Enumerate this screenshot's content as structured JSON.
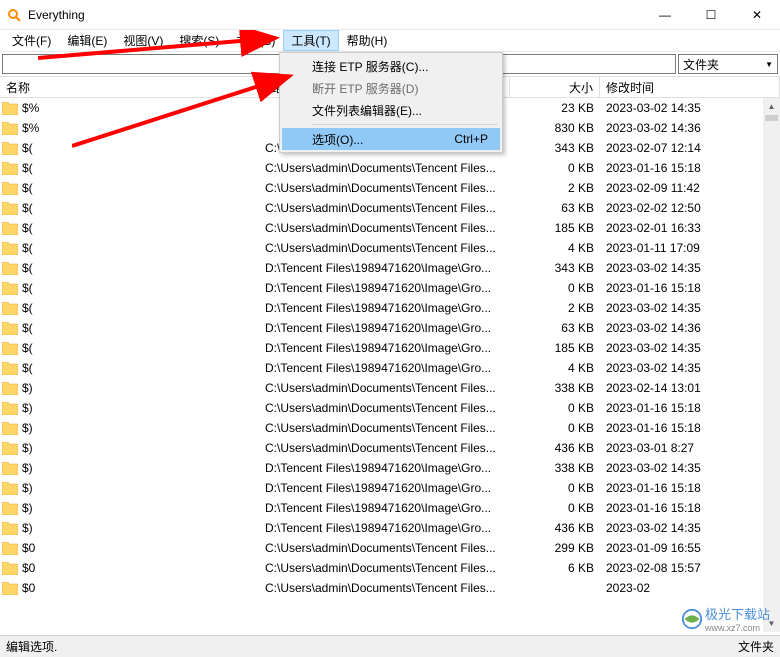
{
  "window": {
    "title": "Everything"
  },
  "win_buttons": {
    "min": "—",
    "max": "☐",
    "close": "✕"
  },
  "menubar": [
    "文件(F)",
    "编辑(E)",
    "视图(V)",
    "搜索(S)",
    "书签(B)",
    "工具(T)",
    "帮助(H)"
  ],
  "search": {
    "value": "",
    "filter": "文件夹"
  },
  "columns": {
    "name": "名称",
    "path": "路",
    "size": "大小",
    "date": "修改时间"
  },
  "dropdown": {
    "items": [
      {
        "label": "连接 ETP 服务器(C)...",
        "shortcut": "",
        "disabled": false,
        "hl": false
      },
      {
        "label": "断开 ETP 服务器(D)",
        "shortcut": "",
        "disabled": true,
        "hl": false
      },
      {
        "label": "文件列表编辑器(E)...",
        "shortcut": "",
        "disabled": false,
        "hl": false
      },
      {
        "sep": true
      },
      {
        "label": "选项(O)...",
        "shortcut": "Ctrl+P",
        "disabled": false,
        "hl": true
      }
    ]
  },
  "rows": [
    {
      "name": "$%",
      "path": "",
      "size": "23 KB",
      "date": "2023-03-02 14:35"
    },
    {
      "name": "$%",
      "path": "",
      "size": "830 KB",
      "date": "2023-03-02 14:36"
    },
    {
      "name": "$(",
      "path": "C:\\sers\\admin\\Documents\\Tencent Files...",
      "size": "343 KB",
      "date": "2023-02-07 12:14"
    },
    {
      "name": "$(",
      "path": "C:\\Users\\admin\\Documents\\Tencent Files...",
      "size": "0 KB",
      "date": "2023-01-16 15:18"
    },
    {
      "name": "$(",
      "path": "C:\\Users\\admin\\Documents\\Tencent Files...",
      "size": "2 KB",
      "date": "2023-02-09 11:42"
    },
    {
      "name": "$(",
      "path": "C:\\Users\\admin\\Documents\\Tencent Files...",
      "size": "63 KB",
      "date": "2023-02-02 12:50"
    },
    {
      "name": "$(",
      "path": "C:\\Users\\admin\\Documents\\Tencent Files...",
      "size": "185 KB",
      "date": "2023-02-01 16:33"
    },
    {
      "name": "$(",
      "path": "C:\\Users\\admin\\Documents\\Tencent Files...",
      "size": "4 KB",
      "date": "2023-01-11 17:09"
    },
    {
      "name": "$(",
      "path": "D:\\Tencent Files\\1989471620\\Image\\Gro...",
      "size": "343 KB",
      "date": "2023-03-02 14:35"
    },
    {
      "name": "$(",
      "path": "D:\\Tencent Files\\1989471620\\Image\\Gro...",
      "size": "0 KB",
      "date": "2023-01-16 15:18"
    },
    {
      "name": "$(",
      "path": "D:\\Tencent Files\\1989471620\\Image\\Gro...",
      "size": "2 KB",
      "date": "2023-03-02 14:35"
    },
    {
      "name": "$(",
      "path": "D:\\Tencent Files\\1989471620\\Image\\Gro...",
      "size": "63 KB",
      "date": "2023-03-02 14:36"
    },
    {
      "name": "$(",
      "path": "D:\\Tencent Files\\1989471620\\Image\\Gro...",
      "size": "185 KB",
      "date": "2023-03-02 14:35"
    },
    {
      "name": "$(",
      "path": "D:\\Tencent Files\\1989471620\\Image\\Gro...",
      "size": "4 KB",
      "date": "2023-03-02 14:35"
    },
    {
      "name": "$)",
      "path": "C:\\Users\\admin\\Documents\\Tencent Files...",
      "size": "338 KB",
      "date": "2023-02-14 13:01"
    },
    {
      "name": "$)",
      "path": "C:\\Users\\admin\\Documents\\Tencent Files...",
      "size": "0 KB",
      "date": "2023-01-16 15:18"
    },
    {
      "name": "$)",
      "path": "C:\\Users\\admin\\Documents\\Tencent Files...",
      "size": "0 KB",
      "date": "2023-01-16 15:18"
    },
    {
      "name": "$)",
      "path": "C:\\Users\\admin\\Documents\\Tencent Files...",
      "size": "436 KB",
      "date": "2023-03-01 8:27"
    },
    {
      "name": "$)",
      "path": "D:\\Tencent Files\\1989471620\\Image\\Gro...",
      "size": "338 KB",
      "date": "2023-03-02 14:35"
    },
    {
      "name": "$)",
      "path": "D:\\Tencent Files\\1989471620\\Image\\Gro...",
      "size": "0 KB",
      "date": "2023-01-16 15:18"
    },
    {
      "name": "$)",
      "path": "D:\\Tencent Files\\1989471620\\Image\\Gro...",
      "size": "0 KB",
      "date": "2023-01-16 15:18"
    },
    {
      "name": "$)",
      "path": "D:\\Tencent Files\\1989471620\\Image\\Gro...",
      "size": "436 KB",
      "date": "2023-03-02 14:35"
    },
    {
      "name": "$0",
      "path": "C:\\Users\\admin\\Documents\\Tencent Files...",
      "size": "299 KB",
      "date": "2023-01-09 16:55"
    },
    {
      "name": "$0",
      "path": "C:\\Users\\admin\\Documents\\Tencent Files...",
      "size": "6 KB",
      "date": "2023-02-08 15:57"
    },
    {
      "name": "$0",
      "path": "C:\\Users\\admin\\Documents\\Tencent Files...",
      "size": "",
      "date": "2023-02"
    }
  ],
  "statusbar": {
    "left": "编辑选项.",
    "right": "文件夹"
  },
  "watermark": {
    "text": "极光下载站",
    "sub": "www.xz7.com"
  }
}
